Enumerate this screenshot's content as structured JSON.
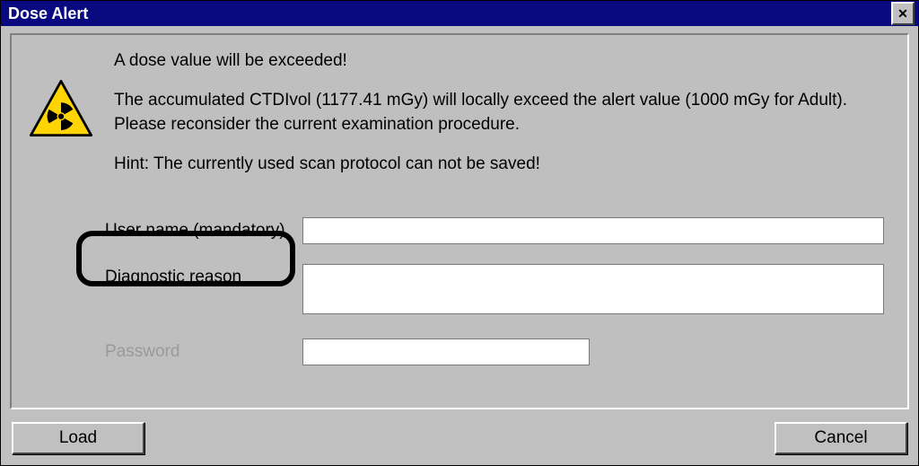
{
  "window": {
    "title": "Dose Alert",
    "close_glyph": "✕"
  },
  "message": {
    "line1": "A dose value will be exceeded!",
    "line2a": "The accumulated CTDIvol (1177.41 mGy) will locally exceed the alert value  (1000 mGy for Adult).",
    "line2b": "Please reconsider the current examination procedure.",
    "hint": "Hint: The currently used scan protocol can not be saved!"
  },
  "form": {
    "username_label": "User name (mandatory)",
    "username_value": "",
    "reason_label": "Diagnostic reason",
    "reason_value": "",
    "password_label": "Password",
    "password_value": ""
  },
  "buttons": {
    "load": "Load",
    "cancel": "Cancel"
  },
  "icons": {
    "warning": "radiation-warning"
  }
}
